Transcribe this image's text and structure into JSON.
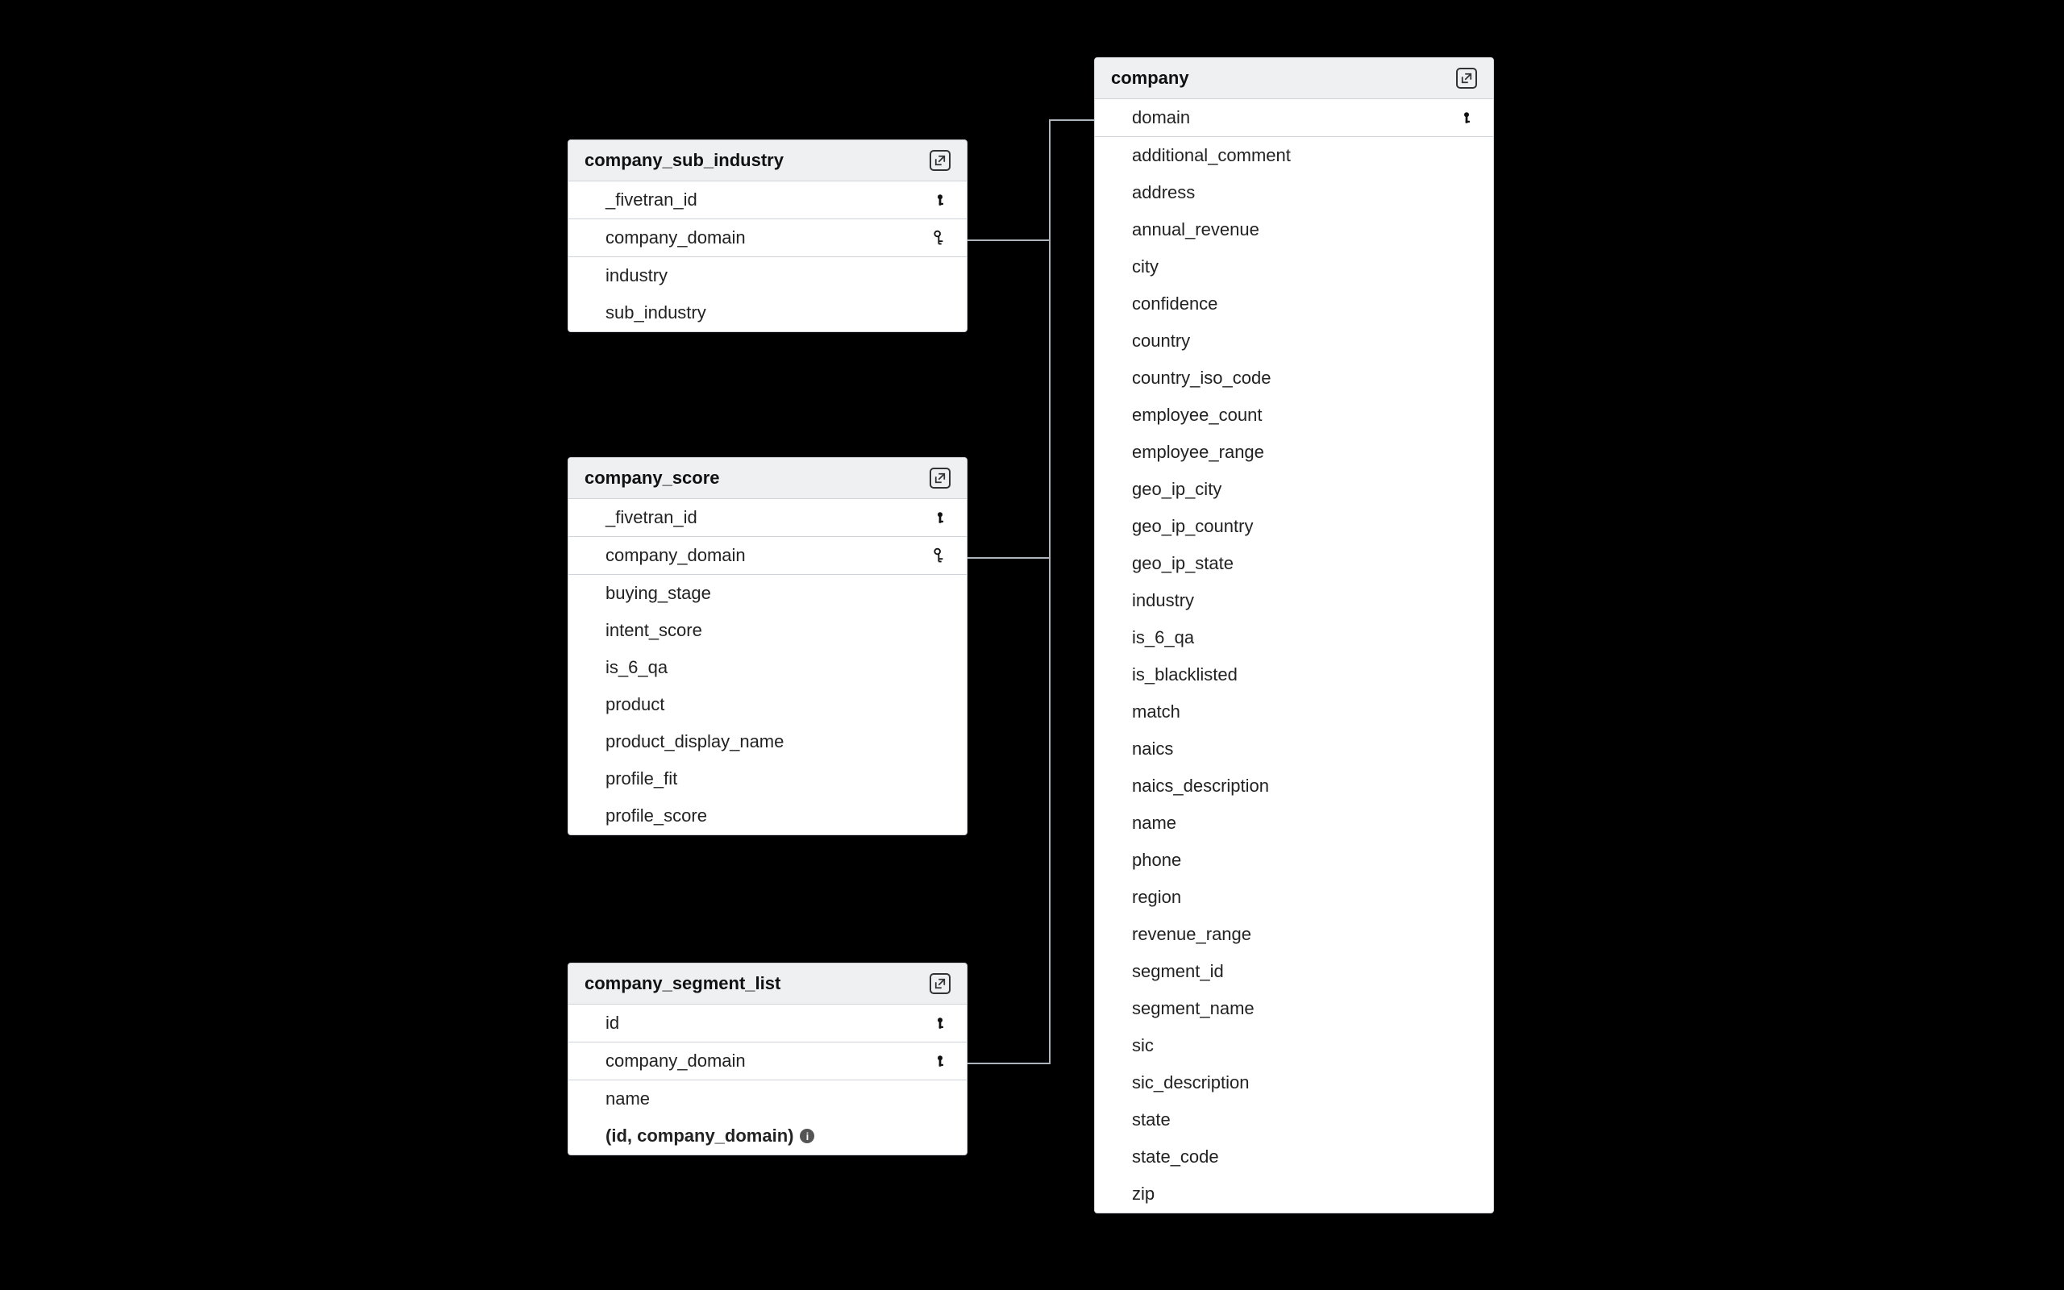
{
  "tables": {
    "company_sub_industry": {
      "title": "company_sub_industry",
      "fields": [
        {
          "name": "_fivetran_id",
          "key": "pk"
        },
        {
          "name": "company_domain",
          "key": "fk"
        },
        {
          "name": "industry",
          "key": null
        },
        {
          "name": "sub_industry",
          "key": null
        }
      ]
    },
    "company_score": {
      "title": "company_score",
      "fields": [
        {
          "name": "_fivetran_id",
          "key": "pk"
        },
        {
          "name": "company_domain",
          "key": "fk"
        },
        {
          "name": "buying_stage",
          "key": null
        },
        {
          "name": "intent_score",
          "key": null
        },
        {
          "name": "is_6_qa",
          "key": null
        },
        {
          "name": "product",
          "key": null
        },
        {
          "name": "product_display_name",
          "key": null
        },
        {
          "name": "profile_fit",
          "key": null
        },
        {
          "name": "profile_score",
          "key": null
        }
      ]
    },
    "company_segment_list": {
      "title": "company_segment_list",
      "fields": [
        {
          "name": "id",
          "key": "pk"
        },
        {
          "name": "company_domain",
          "key": "pk"
        },
        {
          "name": "name",
          "key": null
        }
      ],
      "composite": "(id, company_domain)"
    },
    "company": {
      "title": "company",
      "fields": [
        {
          "name": "domain",
          "key": "pk"
        },
        {
          "name": "additional_comment",
          "key": null
        },
        {
          "name": "address",
          "key": null
        },
        {
          "name": "annual_revenue",
          "key": null
        },
        {
          "name": "city",
          "key": null
        },
        {
          "name": "confidence",
          "key": null
        },
        {
          "name": "country",
          "key": null
        },
        {
          "name": "country_iso_code",
          "key": null
        },
        {
          "name": "employee_count",
          "key": null
        },
        {
          "name": "employee_range",
          "key": null
        },
        {
          "name": "geo_ip_city",
          "key": null
        },
        {
          "name": "geo_ip_country",
          "key": null
        },
        {
          "name": "geo_ip_state",
          "key": null
        },
        {
          "name": "industry",
          "key": null
        },
        {
          "name": "is_6_qa",
          "key": null
        },
        {
          "name": "is_blacklisted",
          "key": null
        },
        {
          "name": "match",
          "key": null
        },
        {
          "name": "naics",
          "key": null
        },
        {
          "name": "naics_description",
          "key": null
        },
        {
          "name": "name",
          "key": null
        },
        {
          "name": "phone",
          "key": null
        },
        {
          "name": "region",
          "key": null
        },
        {
          "name": "revenue_range",
          "key": null
        },
        {
          "name": "segment_id",
          "key": null
        },
        {
          "name": "segment_name",
          "key": null
        },
        {
          "name": "sic",
          "key": null
        },
        {
          "name": "sic_description",
          "key": null
        },
        {
          "name": "state",
          "key": null
        },
        {
          "name": "state_code",
          "key": null
        },
        {
          "name": "zip",
          "key": null
        }
      ]
    }
  },
  "relationships": [
    {
      "from": "company_sub_industry.company_domain",
      "to": "company.domain"
    },
    {
      "from": "company_score.company_domain",
      "to": "company.domain"
    },
    {
      "from": "company_segment_list.company_domain",
      "to": "company.domain"
    }
  ]
}
